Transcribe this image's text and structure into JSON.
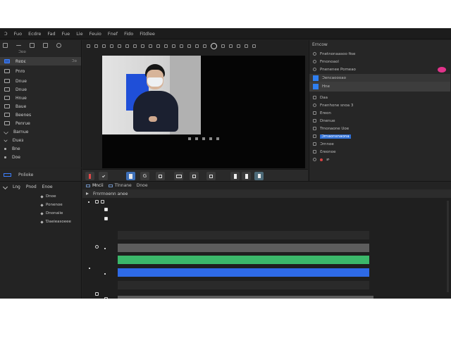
{
  "menu": [
    "Ɔ",
    "Fuo",
    "Ecdre",
    "Fad",
    "Fue",
    "Lie",
    "Feuio",
    "Fnef",
    "Fido",
    "Fitdlee"
  ],
  "left_panel": {
    "section_label": "Ɔɒɒ",
    "items": [
      {
        "icon": "library-icon",
        "label": "Ɍɐɒɛ",
        "right": "Ɔɒ",
        "active": true
      },
      {
        "icon": "folder-icon",
        "label": "Pnro",
        "right": "",
        "active": false
      },
      {
        "icon": "clip-icon",
        "label": "Dnue",
        "right": "",
        "active": false
      },
      {
        "icon": "clip-icon",
        "label": "Dnue",
        "right": "",
        "active": false
      },
      {
        "icon": "clip-icon",
        "label": "Hnue",
        "right": "",
        "active": false
      },
      {
        "icon": "clip-icon",
        "label": "Baue",
        "right": "",
        "active": false
      },
      {
        "icon": "clip-icon",
        "label": "Beenes",
        "right": "",
        "active": false
      },
      {
        "icon": "clip-icon",
        "label": "Penrue",
        "right": "",
        "active": false
      },
      {
        "icon": "chevron-down-icon",
        "label": "Barnue",
        "right": "",
        "active": false
      },
      {
        "icon": "clip-icon",
        "label": "Ɒueɜ",
        "right": "",
        "active": false
      },
      {
        "icon": "clip-icon",
        "label": "Bne",
        "right": "",
        "active": false
      },
      {
        "icon": "clip-icon",
        "label": "Doe",
        "right": "",
        "active": false
      }
    ]
  },
  "inspector": {
    "title": "Erncow",
    "rows": [
      {
        "label": "Fnetnonaasoo fɨse",
        "kind": "normal"
      },
      {
        "label": "Frnonoaol",
        "kind": "normal"
      },
      {
        "label": "Pnenenee Pomeao",
        "kind": "pill"
      },
      {
        "label": "Ɔencaoooao",
        "kind": "blue-sel"
      },
      {
        "label": "Hne",
        "kind": "sel"
      },
      {
        "label": "Daa",
        "kind": "normal"
      },
      {
        "label": "Fnenhone snoa 3",
        "kind": "normal"
      },
      {
        "label": "Ereon",
        "kind": "normal"
      },
      {
        "label": "Dnenue",
        "kind": "normal"
      },
      {
        "label": "Trnonaone Uoe",
        "kind": "normal"
      },
      {
        "label": "Ɔrnaonsnaona",
        "kind": "highlight"
      },
      {
        "label": "Ɔrnnoe",
        "kind": "normal"
      },
      {
        "label": "Ɛreonoe",
        "kind": "normal"
      },
      {
        "label": "ɚ",
        "kind": "red"
      }
    ]
  },
  "mid_tabs": {
    "label": "Pnlioke"
  },
  "bottom_left": {
    "toolbar": [
      "Lnƍ",
      "Pnod",
      "Enoe"
    ],
    "items": [
      "Dnoe",
      "Ponenoe",
      "Dnonaiie",
      "Ɗaeieasoeee"
    ]
  },
  "timeline": {
    "tabs": [
      "Mncii",
      "Tlnnane",
      "Dnoe"
    ],
    "header": "Frnrrnoenn anee"
  },
  "colors": {
    "green_track": "#3bb86a",
    "blue_track": "#2e6ae6",
    "gray_track": "#5d5d5d",
    "accent": "#2e6fd6",
    "pill": "#e2338b"
  }
}
